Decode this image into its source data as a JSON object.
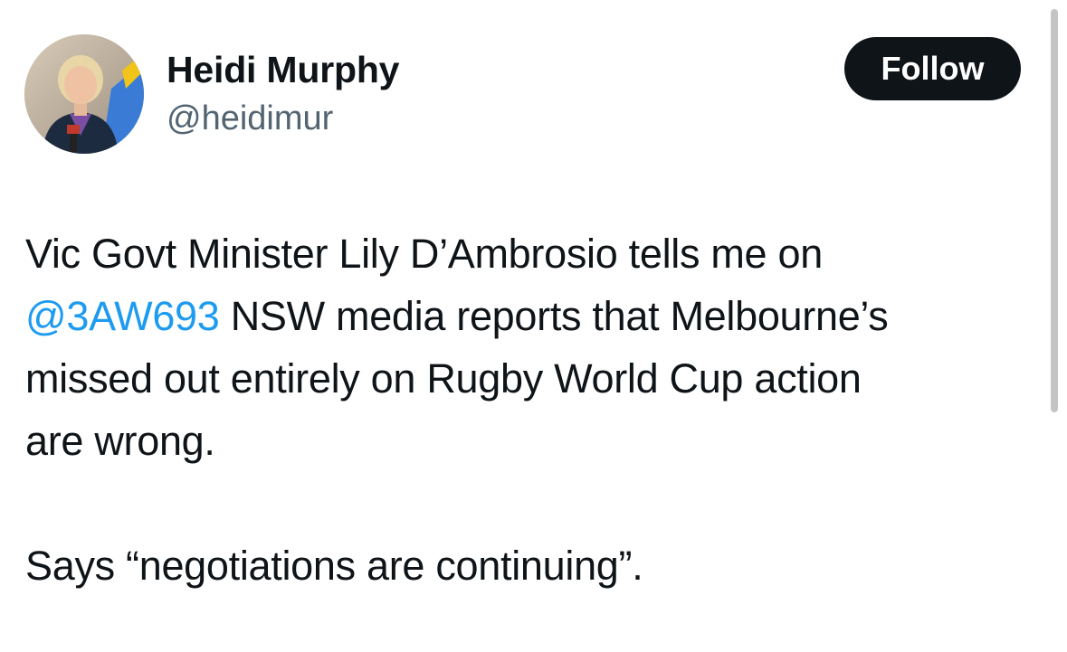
{
  "author": {
    "display_name": "Heidi Murphy",
    "handle": "@heidimur"
  },
  "actions": {
    "follow_label": "Follow"
  },
  "tweet": {
    "line1": "Vic Govt Minister Lily D’Ambrosio tells me on",
    "mention": "@3AW693",
    "line2_rest": " NSW media reports that Melbourne’s",
    "line3": "missed out entirely on Rugby World Cup action",
    "line4": "are wrong.",
    "quote": "Says “negotiations are continuing”."
  },
  "colors": {
    "text": "#0f1419",
    "secondary_text": "#536471",
    "mention": "#1d9bf0",
    "follow_button_bg": "#0f1419",
    "follow_button_text": "#ffffff"
  }
}
